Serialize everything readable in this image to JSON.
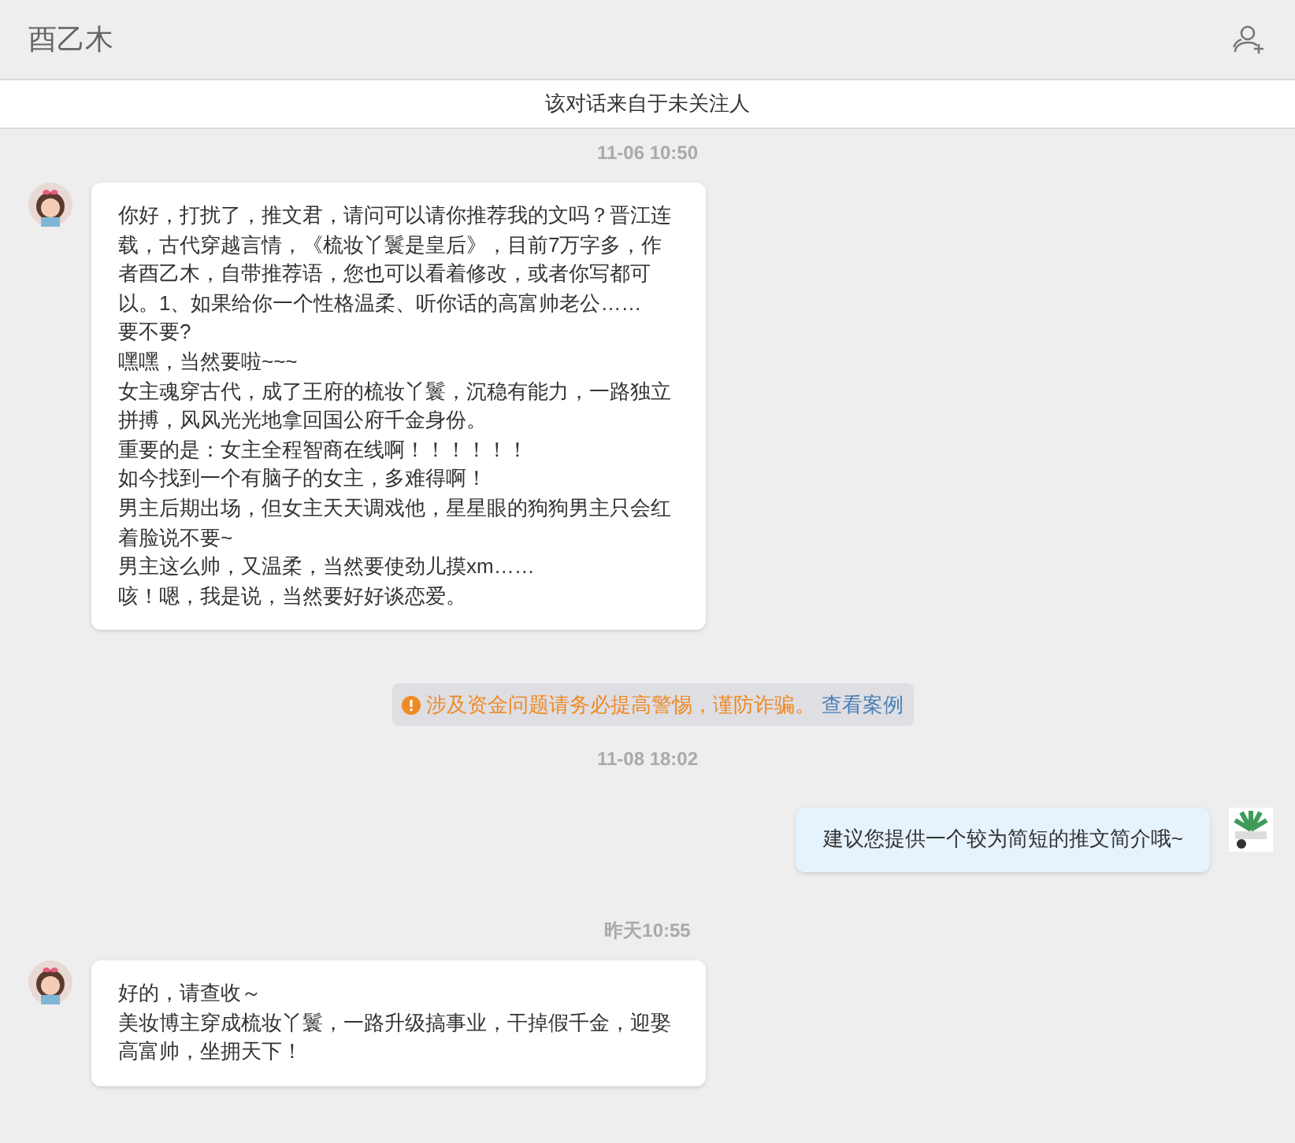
{
  "header": {
    "title": "酉乙木"
  },
  "notice": "该对话来自于未关注人",
  "messages": [
    {
      "kind": "time",
      "text": "11-06 10:50"
    },
    {
      "kind": "incoming",
      "lines": [
        "你好，打扰了，推文君，请问可以请你推荐我的文吗？晋江连载，古代穿越言情，《梳妆丫鬟是皇后》，目前7万字多，作者酉乙木，自带推荐语，您也可以看着修改，或者你写都可以。1、如果给你一个性格温柔、听你话的高富帅老公……",
        "要不要?",
        "嘿嘿，当然要啦~~~",
        "女主魂穿古代，成了王府的梳妆丫鬟，沉稳有能力，一路独立拼搏，风风光光地拿回国公府千金身份。",
        "重要的是：女主全程智商在线啊！！！！！！",
        "如今找到一个有脑子的女主，多难得啊！",
        "男主后期出场，但女主天天调戏他，星星眼的狗狗男主只会红着脸说不要~",
        "男主这么帅，又温柔，当然要使劲儿摸xm……",
        "咳！嗯，我是说，当然要好好谈恋爱。"
      ]
    },
    {
      "kind": "warning",
      "text": "涉及资金问题请务必提高警惕，谨防诈骗。",
      "link": "查看案例"
    },
    {
      "kind": "time",
      "text": "11-08 18:02"
    },
    {
      "kind": "outgoing",
      "lines": [
        "建议您提供一个较为简短的推文简介哦~"
      ]
    },
    {
      "kind": "time",
      "text": "昨天10:55"
    },
    {
      "kind": "incoming",
      "lines": [
        "好的，请查收～",
        "美妆博主穿成梳妆丫鬟，一路升级搞事业，干掉假千金，迎娶高富帅，坐拥天下！"
      ]
    }
  ]
}
